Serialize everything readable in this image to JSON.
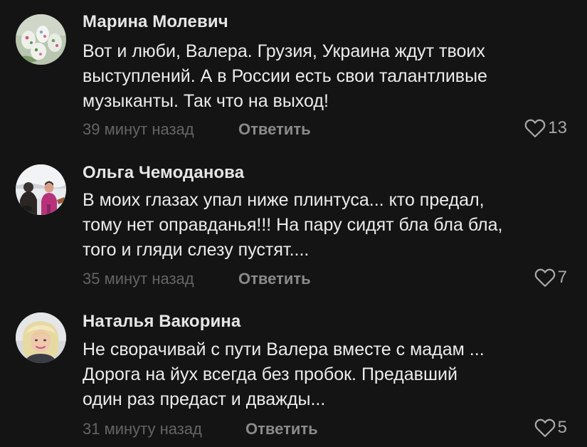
{
  "comments": [
    {
      "author": "Марина Молевич",
      "text_lines": [
        "Вот и люби, Валера. Грузия, Украина ждут твоих",
        "выступлений. А в России есть свои талантливые",
        "музыканты. Так что на выход!"
      ],
      "time": "39 минут назад",
      "reply_label": "Ответить",
      "likes": "13",
      "avatar_icon": "avatar-easter-eggs"
    },
    {
      "author": "Ольга Чемоданова",
      "text_lines": [
        "В моих глазах упал ниже плинтуса... кто предал,",
        "тому нет оправданья!!! На пару сидят бла бла бла,",
        "того и гляди слезу пустят...."
      ],
      "time": "35 минут назад",
      "reply_label": "Ответить",
      "likes": "7",
      "avatar_icon": "avatar-people-snow"
    },
    {
      "author": "Наталья Вакорина",
      "text_lines": [
        "Не сворачивай  с пути Валера вместе с мадам ...",
        "Дорога на йух всегда без пробок. Предавший",
        "один раз предаст и дважды..."
      ],
      "time": "31 минуту назад",
      "reply_label": "Ответить",
      "likes": "5",
      "avatar_icon": "avatar-blonde-woman"
    }
  ],
  "colors": {
    "background": "#141414",
    "author": "#e6e6e6",
    "text": "#ececec",
    "time": "#646464",
    "reply": "#8a8a8a",
    "like": "#a8a8a8"
  }
}
